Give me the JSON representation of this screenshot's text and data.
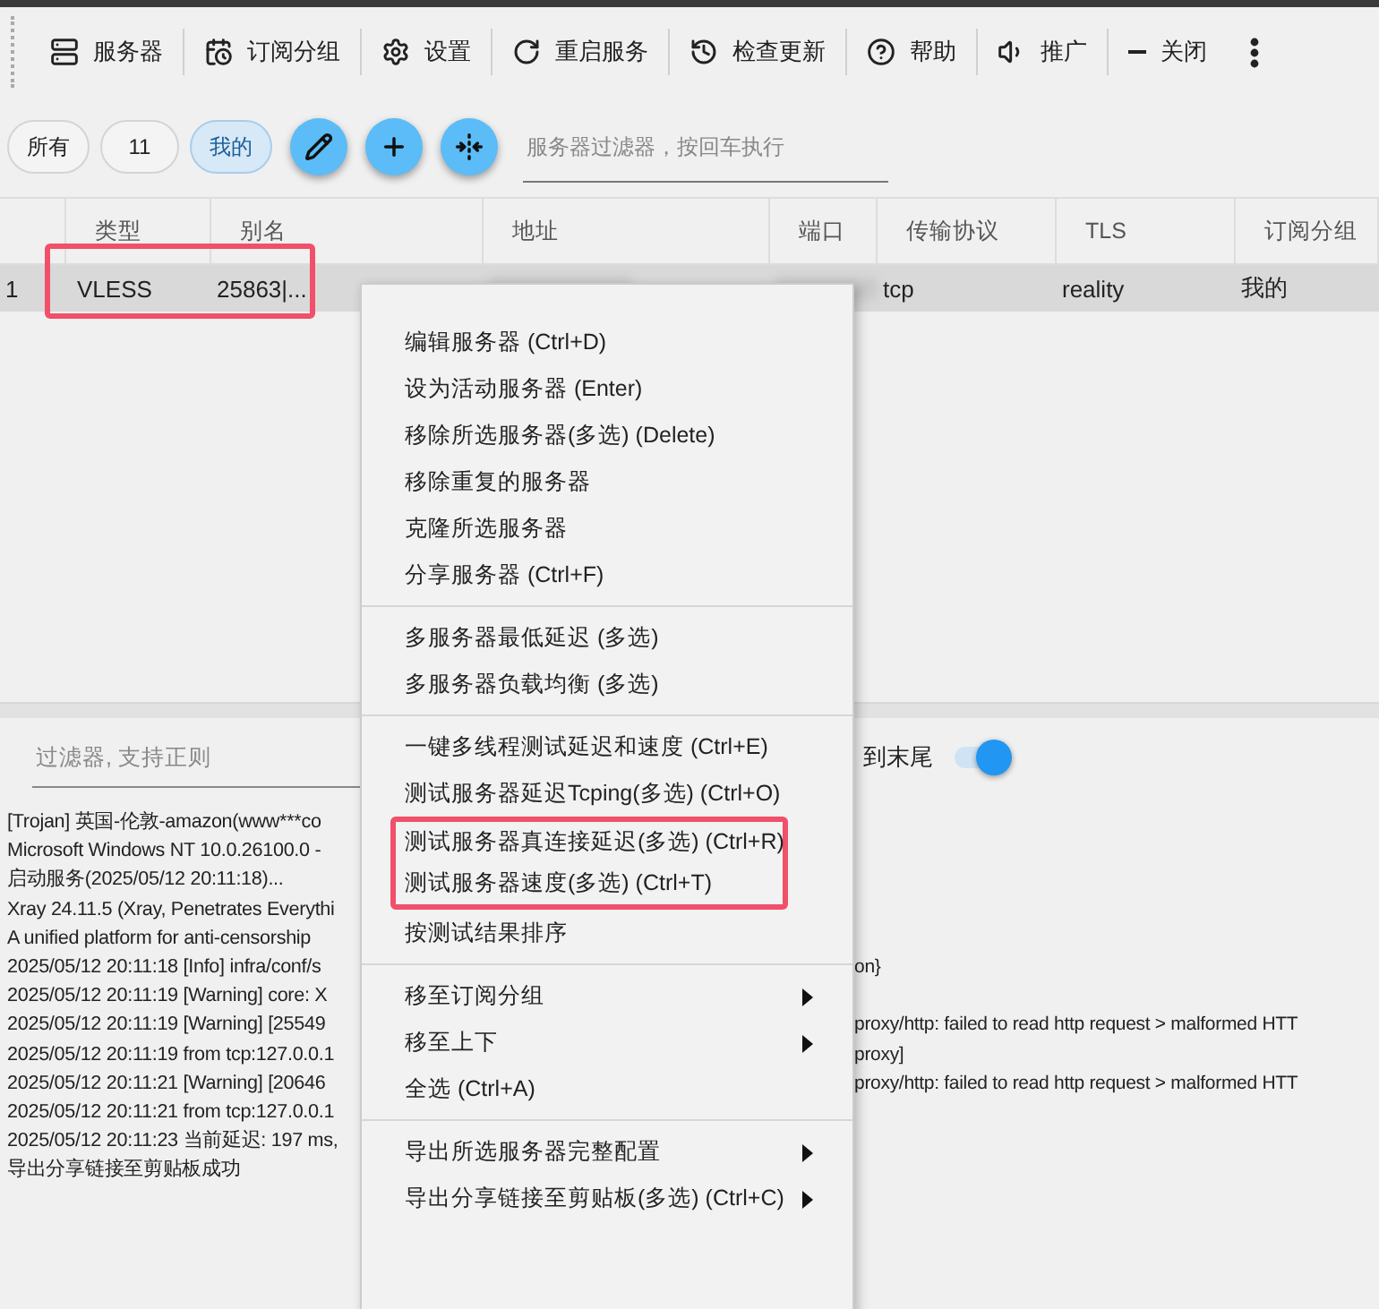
{
  "toolbar": [
    "服务器",
    "订阅分组",
    "设置",
    "重启服务",
    "检查更新",
    "帮助",
    "推广",
    "关闭"
  ],
  "groups": [
    {
      "label": "所有",
      "selected": false
    },
    {
      "label": "11",
      "selected": false
    },
    {
      "label": "我的",
      "selected": true
    }
  ],
  "server_filter": {
    "placeholder": "服务器过滤器，按回车执行"
  },
  "table": {
    "columns": [
      "",
      "类型",
      "别名",
      "地址",
      "端口",
      "传输协议",
      "TLS",
      "订阅分组"
    ],
    "rows": [
      {
        "selected": true,
        "highlighted": true,
        "cells": [
          {
            "text": "1"
          },
          {
            "text": "VLESS"
          },
          {
            "text": "25863|..."
          },
          {
            "kind": "blurred"
          },
          {
            "kind": "blurred"
          },
          {
            "text": "tcp"
          },
          {
            "text": "reality"
          },
          {
            "text": "我的"
          }
        ]
      }
    ]
  },
  "log_filter": {
    "placeholder": "过滤器, 支持正则"
  },
  "autoscroll": {
    "label": "到末尾",
    "on": true
  },
  "log": [
    {
      "left": "[Trojan] 英国-伦敦-amazon(www***co"
    },
    {
      "left": "Microsoft Windows NT 10.0.26100.0 -"
    },
    {
      "left": "启动服务(2025/05/12 20:11:18)..."
    },
    {
      "left": "Xray 24.11.5 (Xray, Penetrates Everythi"
    },
    {
      "left": "A unified platform for anti-censorship"
    },
    {
      "left": "2025/05/12 20:11:18 [Info] infra/conf/s",
      "right": "on}"
    },
    {
      "left": "2025/05/12 20:11:19 [Warning] core: X"
    },
    {
      "left": "2025/05/12 20:11:19 [Warning] [25549",
      "right": "proxy/http: failed to read http request > malformed HTT"
    },
    {
      "left": "2025/05/12 20:11:19 from tcp:127.0.0.1",
      "right": "proxy]"
    },
    {
      "left": "2025/05/12 20:11:21 [Warning] [20646",
      "right": "proxy/http: failed to read http request > malformed HTT"
    },
    {
      "left": "2025/05/12 20:11:21 from tcp:127.0.0.1"
    },
    {
      "left": "2025/05/12 20:11:23 当前延迟: 197 ms,"
    },
    {
      "left": "导出分享链接至剪贴板成功"
    }
  ],
  "context_menu": [
    [
      {
        "label": "编辑服务器 (Ctrl+D)"
      },
      {
        "label": "设为活动服务器 (Enter)"
      },
      {
        "label": "移除所选服务器(多选) (Delete)"
      },
      {
        "label": "移除重复的服务器"
      },
      {
        "label": "克隆所选服务器"
      },
      {
        "label": "分享服务器 (Ctrl+F)"
      }
    ],
    [
      {
        "label": "多服务器最低延迟 (多选)"
      },
      {
        "label": "多服务器负载均衡 (多选)"
      }
    ],
    [
      {
        "label": "一键多线程测试延迟和速度 (Ctrl+E)"
      },
      {
        "label": "测试服务器延迟Tcping(多选) (Ctrl+O)"
      },
      {
        "label": "测试服务器真连接延迟(多选) (Ctrl+R)",
        "highlighted": true
      },
      {
        "label": "测试服务器速度(多选) (Ctrl+T)",
        "highlighted": true
      },
      {
        "label": "按测试结果排序"
      }
    ],
    [
      {
        "label": "移至订阅分组",
        "submenu": true
      },
      {
        "label": "移至上下",
        "submenu": true
      },
      {
        "label": "全选 (Ctrl+A)"
      }
    ],
    [
      {
        "label": "导出所选服务器完整配置",
        "submenu": true
      },
      {
        "label": "导出分享链接至剪贴板(多选) (Ctrl+C)",
        "submenu": true
      }
    ]
  ]
}
